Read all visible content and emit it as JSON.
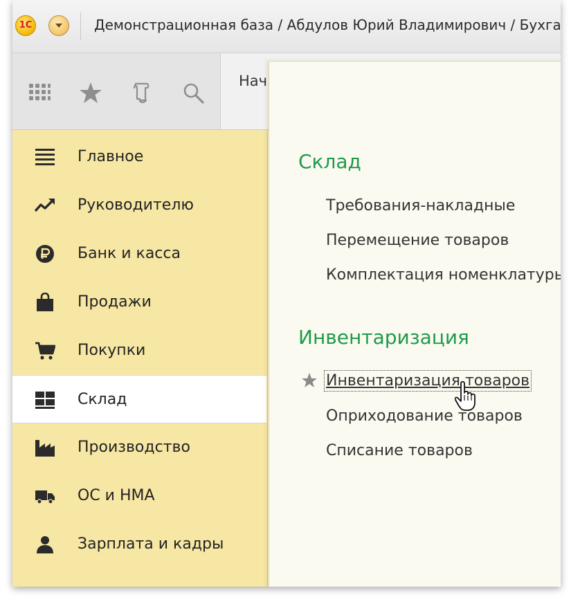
{
  "titlebar": {
    "logo_text": "1С",
    "title": "Демонстрационная база / Абдулов Юрий Владимирович / Бухгалт"
  },
  "toolbar": {
    "icons": [
      "apps-grid-icon",
      "favorites-star-icon",
      "history-scroll-icon",
      "search-icon"
    ],
    "tab_label": "Нач"
  },
  "sidebar": {
    "items": [
      {
        "label": "Главное",
        "icon": "menu-lines-icon"
      },
      {
        "label": "Руководителю",
        "icon": "trend-chart-icon"
      },
      {
        "label": "Банк и касса",
        "icon": "ruble-coin-icon"
      },
      {
        "label": "Продажи",
        "icon": "shopping-bag-icon"
      },
      {
        "label": "Покупки",
        "icon": "cart-icon"
      },
      {
        "label": "Склад",
        "icon": "warehouse-grid-icon",
        "active": true
      },
      {
        "label": "Производство",
        "icon": "factory-icon"
      },
      {
        "label": "ОС и НМА",
        "icon": "truck-icon"
      },
      {
        "label": "Зарплата и кадры",
        "icon": "person-icon"
      }
    ]
  },
  "panel": {
    "sections": [
      {
        "title": "Склад",
        "links": [
          "Требования-накладные",
          "Перемещение товаров",
          "Комплектация номенклатуры"
        ]
      },
      {
        "title": "Инвентаризация",
        "links": [
          "Инвентаризация товаров",
          "Оприходование товаров",
          "Списание товаров"
        ]
      }
    ]
  },
  "colors": {
    "sidebar_bg": "#f7e7a4",
    "section_title": "#1e9a4a",
    "panel_bg": "#fbfaf0"
  }
}
